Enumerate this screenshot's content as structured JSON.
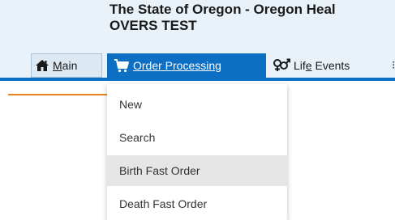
{
  "header": {
    "title": "The State of Oregon - Oregon Heal",
    "subtitle": "OVERS TEST"
  },
  "nav": {
    "items": [
      {
        "label_pre": "",
        "label_ul": "M",
        "label_post": "ain",
        "icon": "home-icon"
      },
      {
        "label": "Order Processing",
        "icon": "shopping-cart-icon"
      },
      {
        "label_pre": "Lif",
        "label_ul": "e",
        "label_post": " Events",
        "icon": "gender-symbol-icon"
      }
    ]
  },
  "dropdown": {
    "items": [
      {
        "label": "New"
      },
      {
        "label": "Search"
      },
      {
        "label": "Birth Fast Order",
        "hovered": true
      },
      {
        "label": "Death Fast Order"
      }
    ]
  },
  "colors": {
    "primary_blue": "#0c6fc4",
    "header_background": "#e9f2f8",
    "accent_orange": "#e8821e",
    "hover_gray": "#e6e6e6"
  }
}
